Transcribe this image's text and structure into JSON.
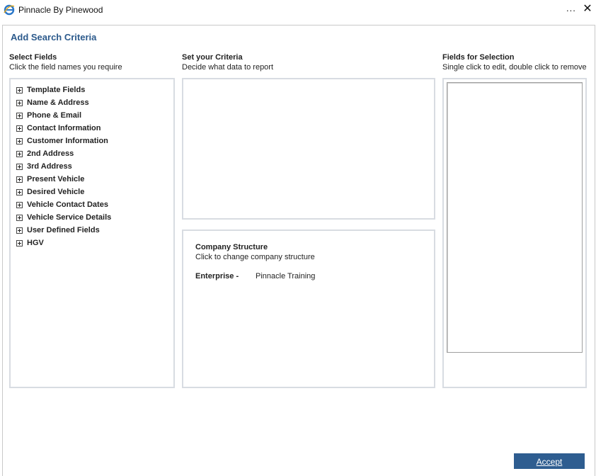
{
  "window": {
    "title": "Pinnacle By Pinewood",
    "more_label": "...",
    "close_label": "✕"
  },
  "page": {
    "heading": "Add Search Criteria"
  },
  "select_fields": {
    "title": "Select Fields",
    "subtitle": "Click the field names you require",
    "items": [
      {
        "label": "Template Fields"
      },
      {
        "label": "Name & Address"
      },
      {
        "label": "Phone & Email"
      },
      {
        "label": "Contact Information"
      },
      {
        "label": "Customer Information"
      },
      {
        "label": "2nd Address"
      },
      {
        "label": "3rd Address"
      },
      {
        "label": "Present Vehicle"
      },
      {
        "label": "Desired Vehicle"
      },
      {
        "label": "Vehicle Contact Dates"
      },
      {
        "label": "Vehicle Service Details"
      },
      {
        "label": "User Defined Fields"
      },
      {
        "label": "HGV"
      }
    ]
  },
  "criteria": {
    "title": "Set your Criteria",
    "subtitle": "Decide what data to report"
  },
  "company_structure": {
    "title": "Company Structure",
    "subtitle": "Click to change company structure",
    "level_label": "Enterprise -",
    "level_value": "Pinnacle Training"
  },
  "fields_for_selection": {
    "title": "Fields for Selection",
    "subtitle": "Single click to edit, double click to remove",
    "items": []
  },
  "footer": {
    "accept_label": "Accept"
  },
  "colors": {
    "heading": "#2c5a8c",
    "accept_button": "#2e5d90",
    "panel_border": "#d8dce2"
  }
}
